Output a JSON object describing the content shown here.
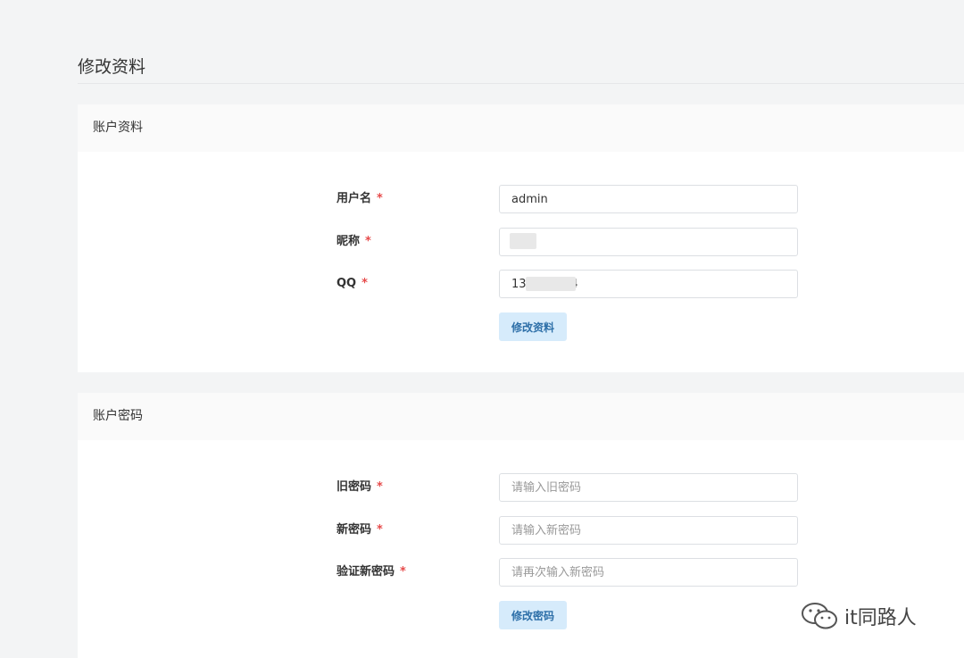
{
  "page": {
    "title": "修改资料"
  },
  "account_profile": {
    "header": "账户资料",
    "fields": [
      {
        "label": "用户名",
        "required": "*",
        "value": "admin",
        "placeholder": ""
      },
      {
        "label": "昵称",
        "required": "*",
        "value": "",
        "placeholder": ""
      },
      {
        "label": "QQ",
        "required": "*",
        "value": "13            4",
        "placeholder": ""
      }
    ],
    "submit_label": "修改资料"
  },
  "account_password": {
    "header": "账户密码",
    "fields": [
      {
        "label": "旧密码",
        "required": "*",
        "value": "",
        "placeholder": "请输入旧密码"
      },
      {
        "label": "新密码",
        "required": "*",
        "value": "",
        "placeholder": "请输入新密码"
      },
      {
        "label": "验证新密码",
        "required": "*",
        "value": "",
        "placeholder": "请再次输入新密码"
      }
    ],
    "submit_label": "修改密码"
  },
  "watermark": {
    "text": "it同路人",
    "icon": "wechat-icon"
  },
  "colors": {
    "background": "#f3f4f5",
    "required_star": "#e64a4a",
    "button_bg": "#d6ebfb",
    "button_text": "#2d6fa8"
  }
}
